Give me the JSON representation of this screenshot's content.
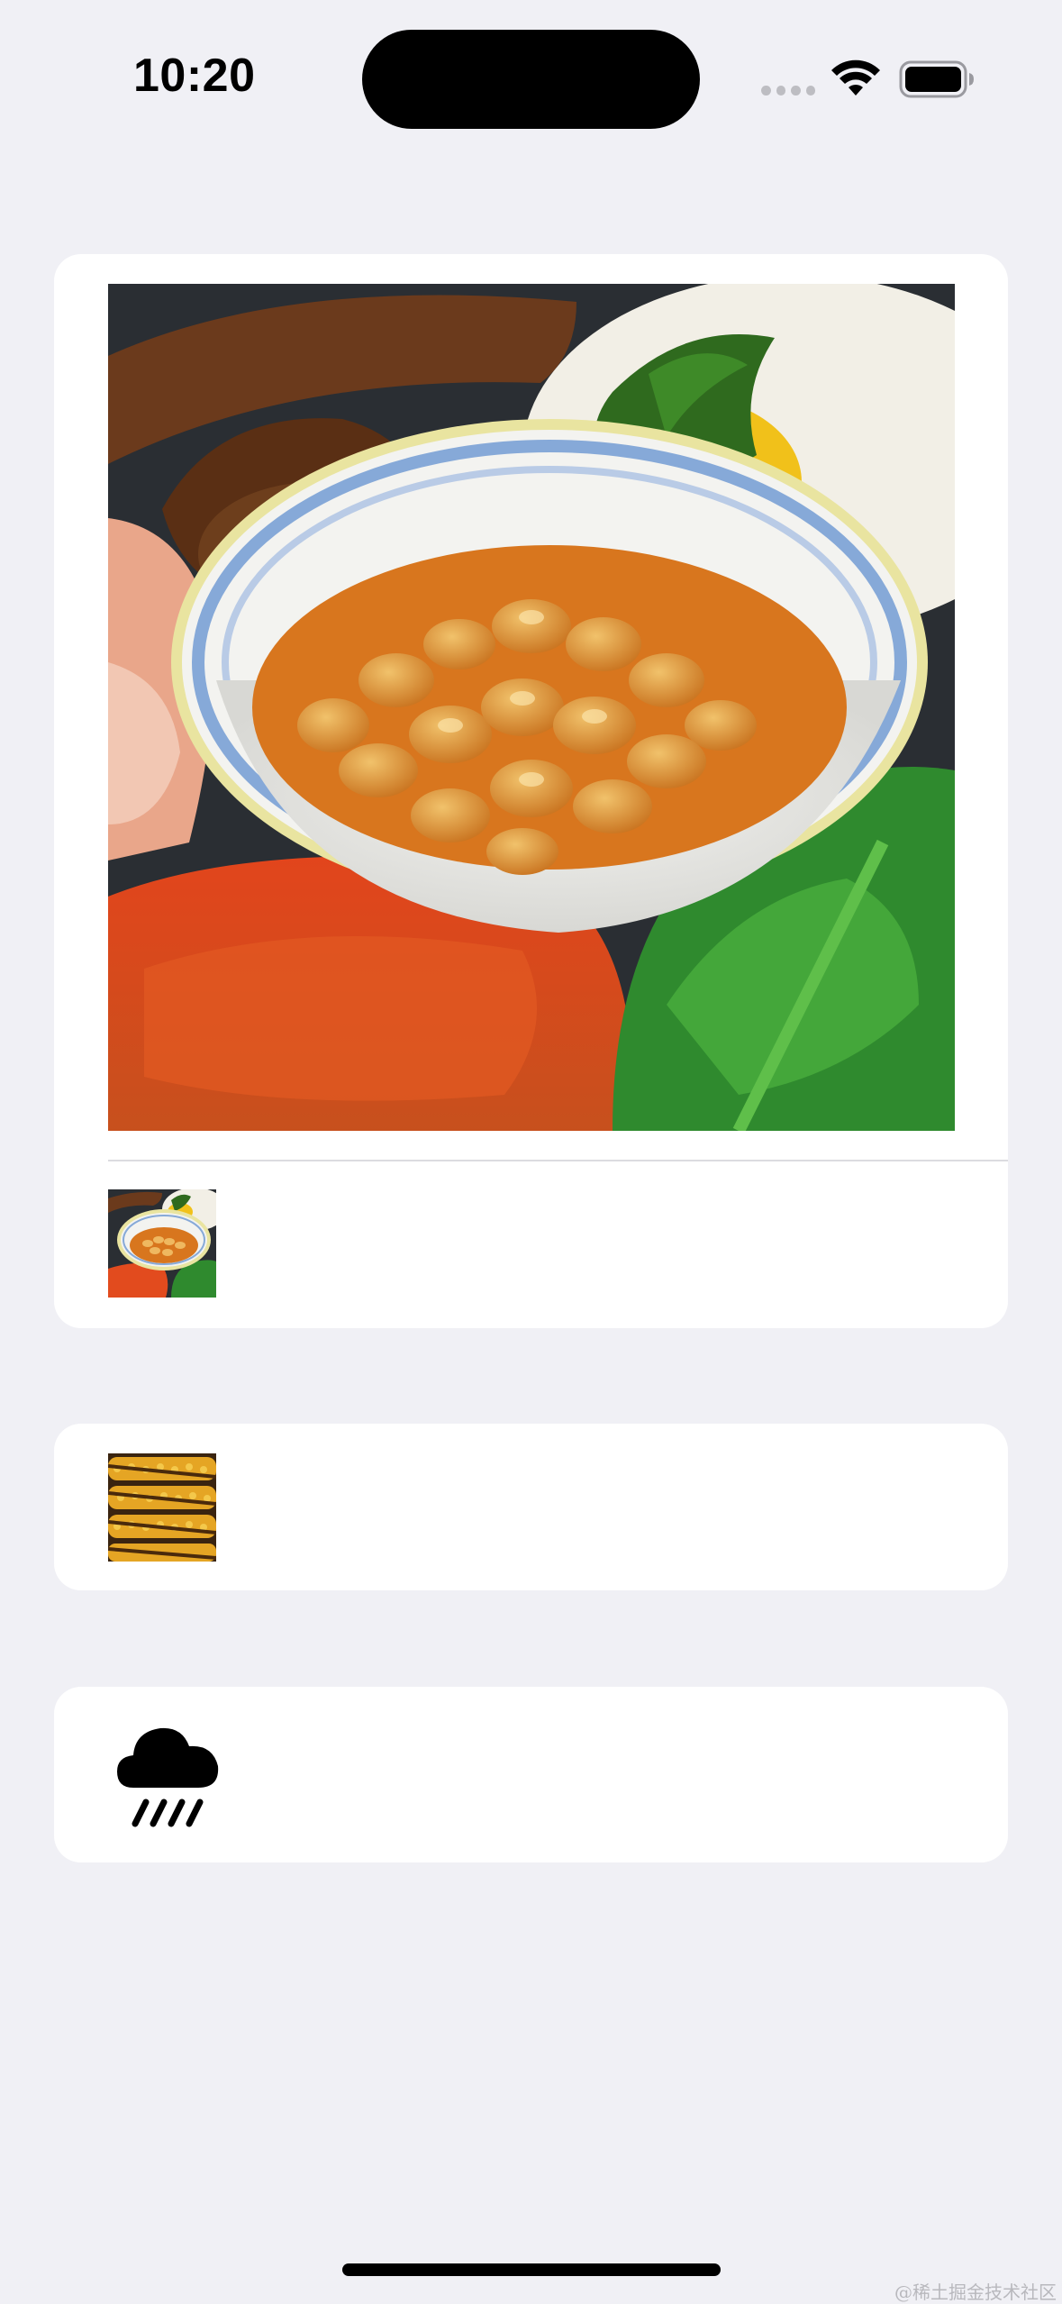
{
  "status_bar": {
    "time": "10:20",
    "icons": [
      "cellular-signal-icon",
      "wifi-icon",
      "battery-icon"
    ]
  },
  "cards": [
    {
      "image": "baked-beans-breakfast-image",
      "thumbnail": "baked-beans-breakfast-thumbnail"
    },
    {
      "thumbnail": "grilled-corn-thumbnail"
    },
    {
      "icon": "cloud-rain-icon"
    }
  ],
  "watermark": "@稀土掘金技术社区"
}
